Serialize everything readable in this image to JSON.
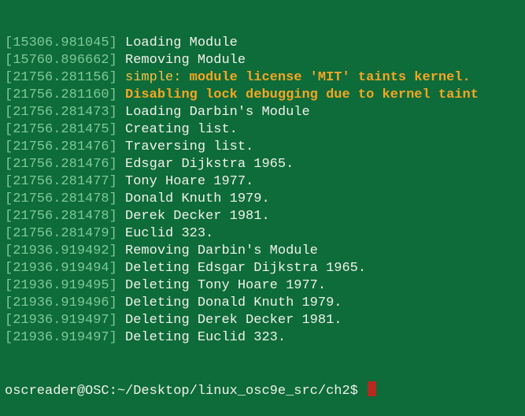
{
  "terminal": {
    "lines": [
      {
        "ts": "[15306.981045]",
        "text": "Loading Module",
        "style": "normal"
      },
      {
        "ts": "[15760.896662]",
        "text": "Removing Module",
        "style": "normal"
      },
      {
        "ts": "[21756.281156]",
        "prefix": "simple:",
        "text": "module license 'MIT' taints kernel.",
        "style": "warn"
      },
      {
        "ts": "[21756.281160]",
        "text": "Disabling lock debugging due to kernel taint",
        "style": "warn"
      },
      {
        "ts": "[21756.281473]",
        "text": "Loading Darbin's Module",
        "style": "normal"
      },
      {
        "ts": "[21756.281475]",
        "text": "Creating list.",
        "style": "normal"
      },
      {
        "ts": "[21756.281476]",
        "text": "Traversing list.",
        "style": "normal"
      },
      {
        "ts": "[21756.281476]",
        "text": "Edsgar Dijkstra 1965.",
        "style": "normal"
      },
      {
        "ts": "[21756.281477]",
        "text": "Tony Hoare 1977.",
        "style": "normal"
      },
      {
        "ts": "[21756.281478]",
        "text": "Donald Knuth 1979.",
        "style": "normal"
      },
      {
        "ts": "[21756.281478]",
        "text": "Derek Decker 1981.",
        "style": "normal"
      },
      {
        "ts": "[21756.281479]",
        "text": "Euclid 323.",
        "style": "normal"
      },
      {
        "ts": "[21936.919492]",
        "text": "Removing Darbin's Module",
        "style": "normal"
      },
      {
        "ts": "[21936.919494]",
        "text": "Deleting Edsgar Dijkstra 1965.",
        "style": "normal"
      },
      {
        "ts": "[21936.919495]",
        "text": "Deleting Tony Hoare 1977.",
        "style": "normal"
      },
      {
        "ts": "[21936.919496]",
        "text": "Deleting Donald Knuth 1979.",
        "style": "normal"
      },
      {
        "ts": "[21936.919497]",
        "text": "Deleting Derek Decker 1981.",
        "style": "normal"
      },
      {
        "ts": "[21936.919497]",
        "text": "Deleting Euclid 323.",
        "style": "normal"
      }
    ],
    "prompt": "oscreader@OSC:~/Desktop/linux_osc9e_src/ch2$ ",
    "colors": {
      "background": "#0e6b3a",
      "timestamp": "#7ec99b",
      "text": "#eef2e8",
      "warning": "#f5a623",
      "cursor": "#b52a1e"
    }
  }
}
